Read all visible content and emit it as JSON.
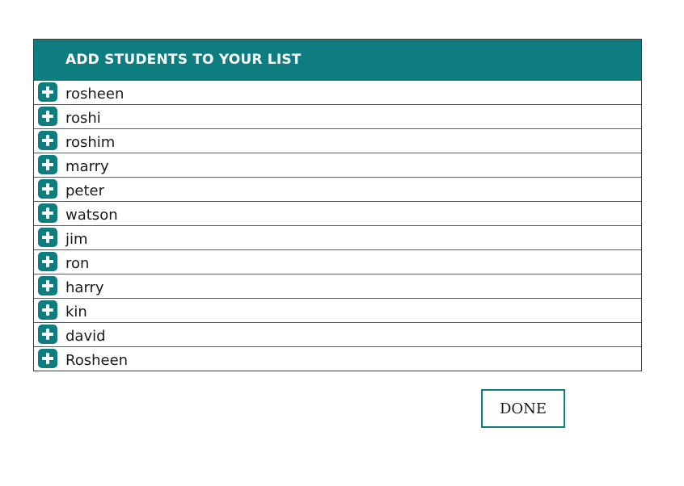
{
  "header": {
    "title": "ADD STUDENTS TO YOUR LIST"
  },
  "students": [
    {
      "name": "rosheen",
      "icon": "plus-icon"
    },
    {
      "name": "roshi",
      "icon": "plus-icon"
    },
    {
      "name": "roshim",
      "icon": "plus-icon"
    },
    {
      "name": "marry",
      "icon": "plus-icon"
    },
    {
      "name": "peter",
      "icon": "plus-icon"
    },
    {
      "name": "watson",
      "icon": "plus-icon"
    },
    {
      "name": "jim",
      "icon": "plus-icon"
    },
    {
      "name": "ron",
      "icon": "plus-icon"
    },
    {
      "name": "harry",
      "icon": "plus-icon"
    },
    {
      "name": "kin",
      "icon": "plus-icon"
    },
    {
      "name": "david",
      "icon": "plus-icon"
    },
    {
      "name": "Rosheen",
      "icon": "plus-icon"
    }
  ],
  "actions": {
    "done_label": "DONE"
  },
  "colors": {
    "accent": "#0e7d80",
    "header_text": "#ffffff",
    "border": "#3a3a3a"
  }
}
